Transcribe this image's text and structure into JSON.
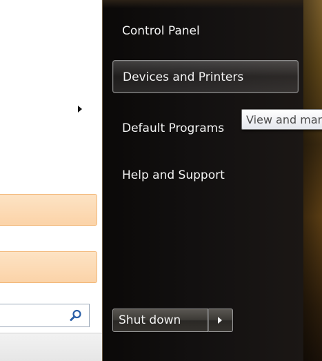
{
  "start_menu": {
    "right_items": [
      {
        "label": "Control Panel"
      },
      {
        "label": "Devices and Printers"
      },
      {
        "label": "Default Programs"
      },
      {
        "label": "Help and Support"
      }
    ],
    "tooltip": "View and manage devices, printers, and print jobs",
    "shutdown_label": "Shut down",
    "icons": {
      "submenu_arrow": "chevron-right-icon",
      "search": "search-icon",
      "shutdown_options": "chevron-right-icon"
    }
  }
}
